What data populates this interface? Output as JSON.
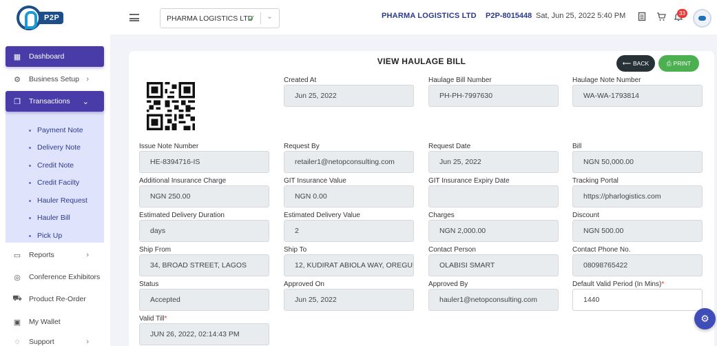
{
  "header": {
    "logo_text": "P2P",
    "org_select_value": "PHARMA LOGISTICS LTD",
    "org_name": "PHARMA LOGISTICS LTD",
    "account_code": "P2P-8015448",
    "datetime": "Sat, Jun 25, 2022 5:40 PM",
    "notification_count": "33"
  },
  "sidebar": {
    "items": [
      {
        "label": "Dashboard",
        "icon": "grid-icon"
      },
      {
        "label": "Business Setup",
        "icon": "gear-icon"
      },
      {
        "label": "Transactions",
        "icon": "copy-icon"
      },
      {
        "label": "Reports",
        "icon": "folder-icon"
      },
      {
        "label": "Conference Exhibitors",
        "icon": "target-icon"
      },
      {
        "label": "Product Re-Order",
        "icon": "cart-icon"
      },
      {
        "label": "My Wallet",
        "icon": "wallet-icon"
      },
      {
        "label": "Support",
        "icon": "help-icon"
      }
    ],
    "sub_items": [
      "Payment Note",
      "Delivery Note",
      "Credit Note",
      "Credit Facilty",
      "Hauler Request",
      "Hauler Bill",
      "Pick Up"
    ]
  },
  "main": {
    "title": "VIEW HAULAGE BILL",
    "back_label": "BACK",
    "print_label": "PRINT",
    "fields": [
      {
        "label": "Created At",
        "value": "Jun 25, 2022"
      },
      {
        "label": "Haulage Bill Number",
        "value": "PH-PH-7997630"
      },
      {
        "label": "Haulage Note Number",
        "value": "WA-WA-1793814"
      },
      {
        "label": "Issue Note Number",
        "value": "HE-8394716-IS"
      },
      {
        "label": "Request By",
        "value": "retailer1@netopconsulting.com"
      },
      {
        "label": "Request Date",
        "value": "Jun 25, 2022"
      },
      {
        "label": "Bill",
        "value": "NGN 50,000.00"
      },
      {
        "label": "Additional Insurance Charge",
        "value": "NGN 250.00"
      },
      {
        "label": "GIT Insurance Value",
        "value": "NGN 0.00"
      },
      {
        "label": "GIT Insurance Expiry Date",
        "value": ""
      },
      {
        "label": "Tracking Portal",
        "value": "https://pharlogistics.com"
      },
      {
        "label": "Estimated Delivery Duration",
        "value": "days"
      },
      {
        "label": "Estimated Delivery Value",
        "value": "2"
      },
      {
        "label": "Charges",
        "value": "NGN 2,000.00"
      },
      {
        "label": "Discount",
        "value": "NGN 500.00"
      },
      {
        "label": "Ship From",
        "value": "34, BROAD STREET, LAGOS"
      },
      {
        "label": "Ship To",
        "value": "12, KUDIRAT ABIOLA WAY, OREGUN"
      },
      {
        "label": "Contact Person",
        "value": "OLABISI SMART"
      },
      {
        "label": "Contact Phone No.",
        "value": "08098765422"
      },
      {
        "label": "Status",
        "value": "Accepted"
      },
      {
        "label": "Approved On",
        "value": "Jun 25, 2022"
      },
      {
        "label": "Approved By",
        "value": "hauler1@netopconsulting.com"
      },
      {
        "label": "Default Valid Period (In Mins)",
        "value": "1440"
      },
      {
        "label": "Valid Till",
        "value": "JUN 26, 2022,  02:14:43 PM"
      }
    ]
  },
  "colors": {
    "primary": "#4a3ca8",
    "submenu_bg": "#dfe3fb",
    "back_button": "#263238",
    "print_button": "#4caf50",
    "brand_text": "#2b3a8f"
  }
}
